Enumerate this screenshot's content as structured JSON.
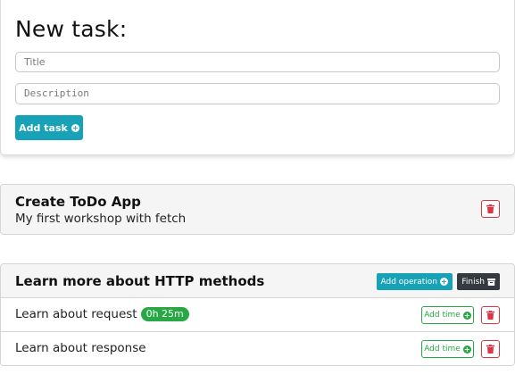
{
  "new_task": {
    "heading": "New task:",
    "title_placeholder": "Title",
    "description_placeholder": "Description",
    "add_button_label": "Add task"
  },
  "tasks": [
    {
      "title": "Create ToDo App",
      "description": "My first workshop with fetch"
    },
    {
      "title": "Learn more about HTTP methods",
      "add_operation_label": "Add operation",
      "finish_label": "Finish",
      "operations": [
        {
          "description": "Learn about request",
          "time": "0h 25m",
          "add_time_label": "Add time"
        },
        {
          "description": "Learn about response",
          "add_time_label": "Add time"
        }
      ]
    }
  ],
  "colors": {
    "primary": "#17a2b8",
    "danger": "#dc3545",
    "success": "#28a745",
    "dark": "#343a40"
  },
  "icons": {
    "add": "plus-circle-icon",
    "delete": "trash-icon",
    "finish": "archive-icon"
  }
}
